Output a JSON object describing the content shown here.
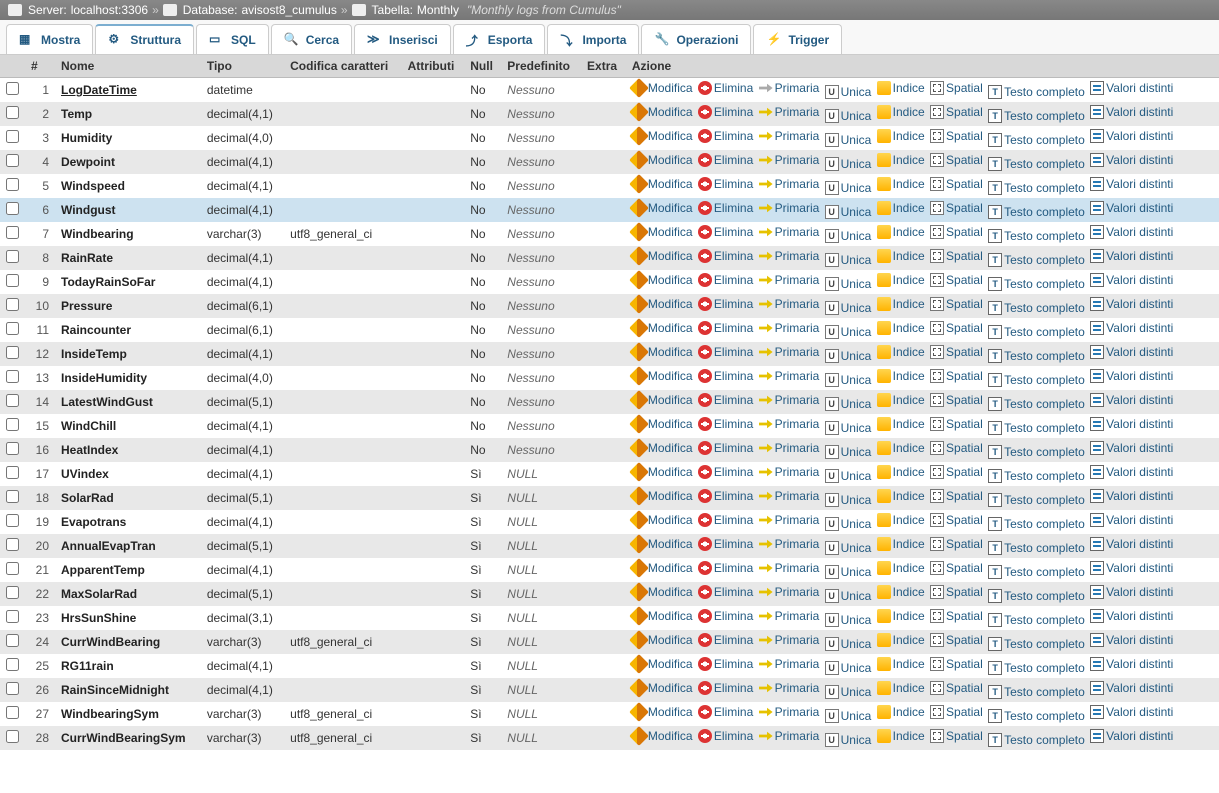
{
  "breadcrumb": {
    "server_label": "Server:",
    "server_value": "localhost:3306",
    "db_label": "Database:",
    "db_value": "avisost8_cumulus",
    "table_label": "Tabella:",
    "table_value": "Monthly",
    "comment": "\"Monthly logs from Cumulus\""
  },
  "tabs": [
    {
      "id": "mostra",
      "label": "Mostra"
    },
    {
      "id": "struttura",
      "label": "Struttura"
    },
    {
      "id": "sql",
      "label": "SQL"
    },
    {
      "id": "cerca",
      "label": "Cerca"
    },
    {
      "id": "inserisci",
      "label": "Inserisci"
    },
    {
      "id": "esporta",
      "label": "Esporta"
    },
    {
      "id": "importa",
      "label": "Importa"
    },
    {
      "id": "operazioni",
      "label": "Operazioni"
    },
    {
      "id": "trigger",
      "label": "Trigger"
    }
  ],
  "headers": {
    "num": "#",
    "name": "Nome",
    "type": "Tipo",
    "collation": "Codifica caratteri",
    "attr": "Attributi",
    "null": "Null",
    "default": "Predefinito",
    "extra": "Extra",
    "action": "Azione"
  },
  "action_labels": {
    "edit": "Modifica",
    "delete": "Elimina",
    "primary": "Primaria",
    "unique": "Unica",
    "index": "Indice",
    "spatial": "Spatial",
    "fulltext": "Testo completo",
    "distinct": "Valori distinti"
  },
  "null_default_nessuno": "Nessuno",
  "null_default_null": "NULL",
  "columns": [
    {
      "n": 1,
      "name": "LogDateTime",
      "type": "datetime",
      "coll": "",
      "null": "No",
      "def": "Nessuno",
      "pk": true,
      "hl": false
    },
    {
      "n": 2,
      "name": "Temp",
      "type": "decimal(4,1)",
      "coll": "",
      "null": "No",
      "def": "Nessuno",
      "hl": false
    },
    {
      "n": 3,
      "name": "Humidity",
      "type": "decimal(4,0)",
      "coll": "",
      "null": "No",
      "def": "Nessuno",
      "hl": false
    },
    {
      "n": 4,
      "name": "Dewpoint",
      "type": "decimal(4,1)",
      "coll": "",
      "null": "No",
      "def": "Nessuno",
      "hl": false
    },
    {
      "n": 5,
      "name": "Windspeed",
      "type": "decimal(4,1)",
      "coll": "",
      "null": "No",
      "def": "Nessuno",
      "hl": false
    },
    {
      "n": 6,
      "name": "Windgust",
      "type": "decimal(4,1)",
      "coll": "",
      "null": "No",
      "def": "Nessuno",
      "hl": true
    },
    {
      "n": 7,
      "name": "Windbearing",
      "type": "varchar(3)",
      "coll": "utf8_general_ci",
      "null": "No",
      "def": "Nessuno",
      "hl": false
    },
    {
      "n": 8,
      "name": "RainRate",
      "type": "decimal(4,1)",
      "coll": "",
      "null": "No",
      "def": "Nessuno",
      "hl": false
    },
    {
      "n": 9,
      "name": "TodayRainSoFar",
      "type": "decimal(4,1)",
      "coll": "",
      "null": "No",
      "def": "Nessuno",
      "hl": false
    },
    {
      "n": 10,
      "name": "Pressure",
      "type": "decimal(6,1)",
      "coll": "",
      "null": "No",
      "def": "Nessuno",
      "hl": false
    },
    {
      "n": 11,
      "name": "Raincounter",
      "type": "decimal(6,1)",
      "coll": "",
      "null": "No",
      "def": "Nessuno",
      "hl": false
    },
    {
      "n": 12,
      "name": "InsideTemp",
      "type": "decimal(4,1)",
      "coll": "",
      "null": "No",
      "def": "Nessuno",
      "hl": false
    },
    {
      "n": 13,
      "name": "InsideHumidity",
      "type": "decimal(4,0)",
      "coll": "",
      "null": "No",
      "def": "Nessuno",
      "hl": false
    },
    {
      "n": 14,
      "name": "LatestWindGust",
      "type": "decimal(5,1)",
      "coll": "",
      "null": "No",
      "def": "Nessuno",
      "hl": false
    },
    {
      "n": 15,
      "name": "WindChill",
      "type": "decimal(4,1)",
      "coll": "",
      "null": "No",
      "def": "Nessuno",
      "hl": false
    },
    {
      "n": 16,
      "name": "HeatIndex",
      "type": "decimal(4,1)",
      "coll": "",
      "null": "No",
      "def": "Nessuno",
      "hl": false
    },
    {
      "n": 17,
      "name": "UVindex",
      "type": "decimal(4,1)",
      "coll": "",
      "null": "Sì",
      "def": "NULL",
      "hl": false
    },
    {
      "n": 18,
      "name": "SolarRad",
      "type": "decimal(5,1)",
      "coll": "",
      "null": "Sì",
      "def": "NULL",
      "hl": false
    },
    {
      "n": 19,
      "name": "Evapotrans",
      "type": "decimal(4,1)",
      "coll": "",
      "null": "Sì",
      "def": "NULL",
      "hl": false
    },
    {
      "n": 20,
      "name": "AnnualEvapTran",
      "type": "decimal(5,1)",
      "coll": "",
      "null": "Sì",
      "def": "NULL",
      "hl": false
    },
    {
      "n": 21,
      "name": "ApparentTemp",
      "type": "decimal(4,1)",
      "coll": "",
      "null": "Sì",
      "def": "NULL",
      "hl": false
    },
    {
      "n": 22,
      "name": "MaxSolarRad",
      "type": "decimal(5,1)",
      "coll": "",
      "null": "Sì",
      "def": "NULL",
      "hl": false
    },
    {
      "n": 23,
      "name": "HrsSunShine",
      "type": "decimal(3,1)",
      "coll": "",
      "null": "Sì",
      "def": "NULL",
      "hl": false
    },
    {
      "n": 24,
      "name": "CurrWindBearing",
      "type": "varchar(3)",
      "coll": "utf8_general_ci",
      "null": "Sì",
      "def": "NULL",
      "hl": false
    },
    {
      "n": 25,
      "name": "RG11rain",
      "type": "decimal(4,1)",
      "coll": "",
      "null": "Sì",
      "def": "NULL",
      "hl": false
    },
    {
      "n": 26,
      "name": "RainSinceMidnight",
      "type": "decimal(4,1)",
      "coll": "",
      "null": "Sì",
      "def": "NULL",
      "hl": false
    },
    {
      "n": 27,
      "name": "WindbearingSym",
      "type": "varchar(3)",
      "coll": "utf8_general_ci",
      "null": "Sì",
      "def": "NULL",
      "hl": false
    },
    {
      "n": 28,
      "name": "CurrWindBearingSym",
      "type": "varchar(3)",
      "coll": "utf8_general_ci",
      "null": "Sì",
      "def": "NULL",
      "hl": false
    }
  ]
}
